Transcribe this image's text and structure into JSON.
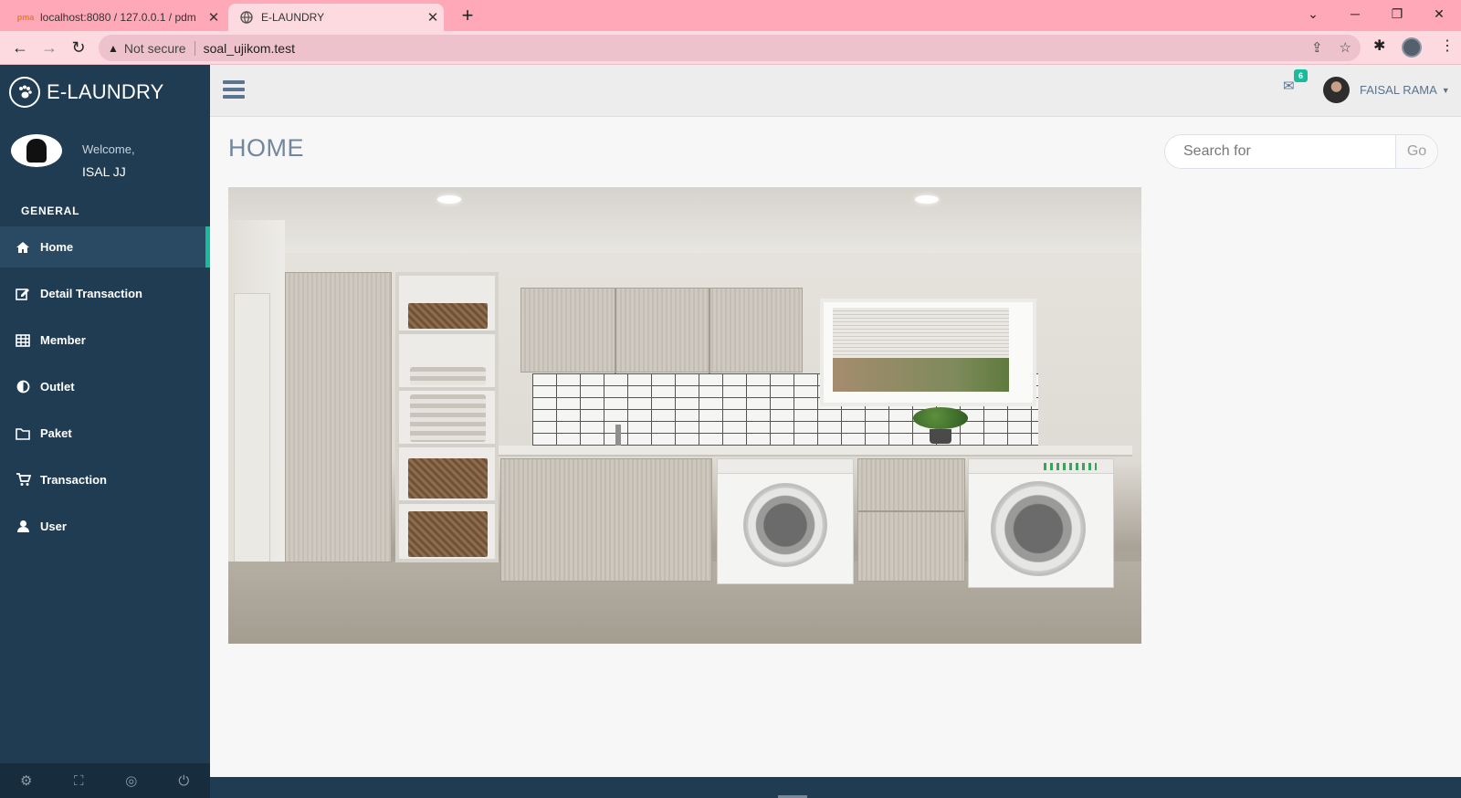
{
  "browser": {
    "tabs": [
      {
        "title": "localhost:8080 / 127.0.0.1 / pdm",
        "favicon": "phpmyadmin-icon"
      },
      {
        "title": "E-LAUNDRY",
        "favicon": "globe-icon"
      }
    ],
    "security_label": "Not secure",
    "url": "soal_ujikom.test"
  },
  "sidebar": {
    "brand": "E-LAUNDRY",
    "welcome": "Welcome,",
    "username": "ISAL JJ",
    "section": "GENERAL",
    "items": [
      {
        "label": "Home",
        "icon": "home-icon"
      },
      {
        "label": "Detail Transaction",
        "icon": "edit-icon"
      },
      {
        "label": "Member",
        "icon": "table-icon"
      },
      {
        "label": "Outlet",
        "icon": "adjust-icon"
      },
      {
        "label": "Paket",
        "icon": "folder-icon"
      },
      {
        "label": "Transaction",
        "icon": "cart-icon"
      },
      {
        "label": "User",
        "icon": "user-icon"
      }
    ]
  },
  "topnav": {
    "mail_count": "6",
    "user_name": "FAISAL RAMA"
  },
  "main": {
    "title": "HOME",
    "search_placeholder": "Search for",
    "search_button": "Go"
  },
  "colors": {
    "sidebar": "#203c53",
    "accent": "#1abb9c",
    "tabbar": "#ffa8b8",
    "text_muted": "#73879c"
  }
}
